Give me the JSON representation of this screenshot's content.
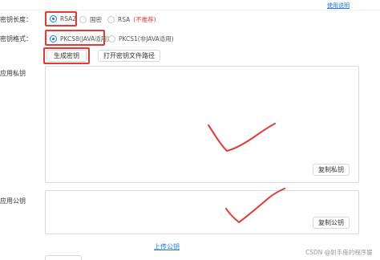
{
  "header": {
    "help_link": "使用说明"
  },
  "key_length": {
    "label": "密钥长度：",
    "options": [
      {
        "label": "RSA2",
        "checked": true
      },
      {
        "label": "国密",
        "checked": false
      },
      {
        "label": "RSA",
        "checked": false
      }
    ],
    "rsa_note": "(不推荐)"
  },
  "key_format": {
    "label": "密钥格式：",
    "options": [
      {
        "label": "PKCS8(JAVA适用)",
        "checked": true
      },
      {
        "label": "PKCS1(非JAVA适用)",
        "checked": false
      }
    ]
  },
  "actions": {
    "generate_label": "生成密钥",
    "open_path_label": "打开密钥文件路径"
  },
  "private_key": {
    "label": "应用私钥",
    "value": "",
    "copy_label": "复制私钥"
  },
  "public_key": {
    "label": "应用公钥",
    "value": "",
    "copy_label": "复制公钥"
  },
  "footer": {
    "upload_link": "上传公钥",
    "watermark": "CSDN @射手座的程序媛"
  },
  "colors": {
    "accent": "#1677ff",
    "annotation_red": "#e53935",
    "border": "#d9d9d9"
  }
}
